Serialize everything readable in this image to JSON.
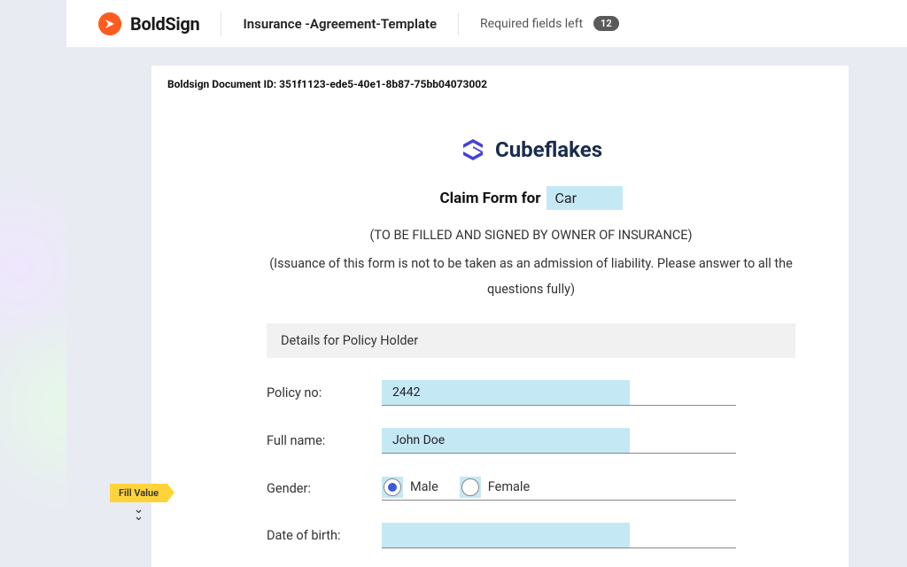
{
  "header": {
    "brand": "BoldSign",
    "document_title": "Insurance -Agreement-Template",
    "required_label": "Required fields left",
    "required_count": "12"
  },
  "document": {
    "doc_id_line": "Boldsign Document ID: 351f1123-ede5-40e1-8b87-75bb04073002",
    "company": "Cubeflakes",
    "form_title": "Claim Form for",
    "claim_type": "Car",
    "instruction_1": "(TO BE FILLED AND SIGNED BY OWNER OF INSURANCE)",
    "instruction_2": "(Issuance of this form is not to be taken as an admission of liability. Please answer to all the questions fully)",
    "section_title": "Details for Policy Holder",
    "fields": {
      "policy_no_label": "Policy no:",
      "policy_no_value": "2442",
      "full_name_label": "Full name:",
      "full_name_value": "John Doe",
      "gender_label": "Gender:",
      "gender_male": "Male",
      "gender_female": "Female",
      "dob_label": "Date of birth:",
      "dob_value": ""
    }
  },
  "sidebar": {
    "fill_value_label": "Fill Value"
  }
}
